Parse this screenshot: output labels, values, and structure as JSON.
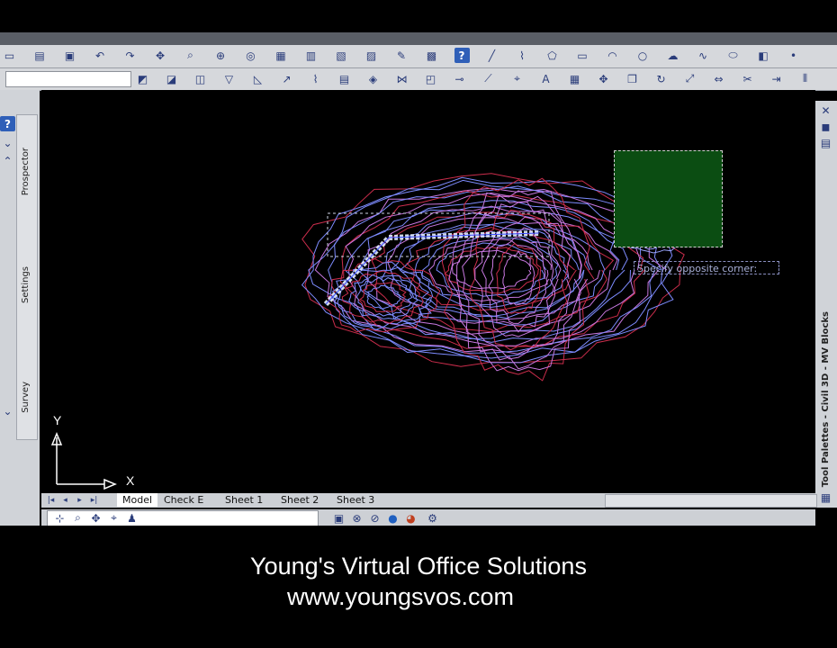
{
  "layout_tabs": [
    "Model",
    "Check E",
    "Sheet 1",
    "Sheet 2",
    "Sheet 3"
  ],
  "left_panel_tabs": [
    "Prospector",
    "Settings",
    "Survey"
  ],
  "right_panel_title": "Tool Palettes - Civil 3D - MV Blocks",
  "command_prompt": "Specify opposite corner:",
  "axis": {
    "x": "X",
    "y": "Y"
  },
  "caption": {
    "line1": "Young's Virtual Office Solutions",
    "line2": "www.youngsvos.com"
  },
  "colors": {
    "canvas": "#000000",
    "contour_blue": "#7e8cff",
    "contour_magenta": "#c878e0",
    "contour_red": "#cc2d4c",
    "selection_fill": "#0b4d12"
  },
  "icons": {
    "toolbar1": [
      "new-icon",
      "open-icon",
      "save-icon",
      "undo-icon",
      "redo-icon",
      "pan-icon",
      "zoom-icon",
      "zoom-window-icon",
      "orbit-icon",
      "properties-icon",
      "design-center-icon",
      "tool-palettes-icon",
      "sheet-set-icon",
      "markup-icon",
      "calculator-icon",
      "help-icon",
      "line-icon",
      "polyline-icon",
      "polygon-icon",
      "rectangle-icon",
      "arc-icon",
      "circle-icon",
      "cloud-icon",
      "spline-icon",
      "ellipse-icon",
      "block-icon",
      "point-icon"
    ],
    "toolbar2": [
      "layer-icon",
      "layer-state-icon",
      "layer-previous-icon",
      "point-tool-icon",
      "surface-tool-icon",
      "alignment-icon",
      "profile-icon",
      "section-icon",
      "grading-icon",
      "corridor-icon",
      "parcel-icon",
      "pipe-icon",
      "feature-line-icon",
      "survey-icon",
      "label-icon",
      "table-icon",
      "move-icon",
      "copy-icon",
      "rotate-icon",
      "scale-icon",
      "stretch-icon",
      "trim-icon",
      "extend-icon",
      "offset-icon"
    ]
  }
}
